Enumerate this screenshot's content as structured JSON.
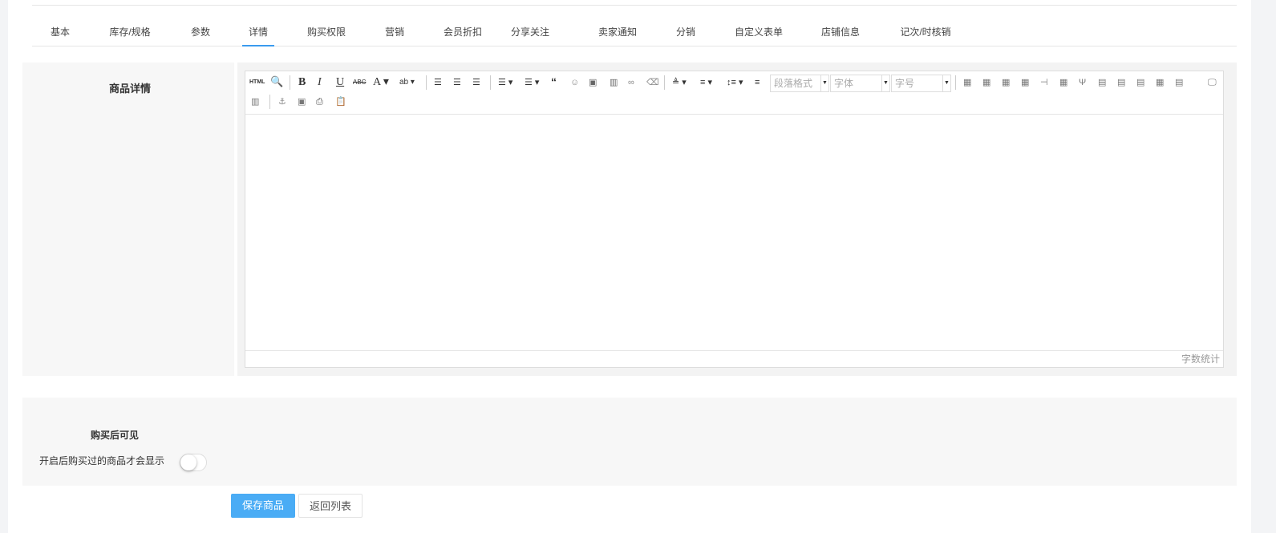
{
  "tabs": [
    "基本",
    "库存/规格",
    "参数",
    "详情",
    "购买权限",
    "营销",
    "会员折扣",
    "分享关注",
    "卖家通知",
    "分销",
    "自定义表单",
    "店铺信息",
    "记次/时核销"
  ],
  "active_tab": "详情",
  "detail": {
    "label": "商品详情",
    "editor": {
      "toolbar_icons": [
        "html-icon",
        "preview-icon",
        "bold-icon",
        "italic-icon",
        "underline-icon",
        "strikethrough-icon",
        "font-color-icon",
        "highlight-icon",
        "align-left-icon",
        "align-center-icon",
        "align-right-icon",
        "ordered-list-icon",
        "unordered-list-icon",
        "blockquote-icon",
        "emoji-icon",
        "image-icon",
        "video-icon",
        "link-icon",
        "eraser-icon",
        "paragraph-spacing-top-icon",
        "paragraph-spacing-bottom-icon",
        "line-height-icon",
        "indent-icon",
        "table-icons",
        "fullscreen-icon",
        "anchor-icon",
        "insert-frame-icon",
        "print-icon",
        "paste-icon"
      ],
      "html_label": "HTML",
      "paragraph_placeholder": "段落格式",
      "font_placeholder": "字体",
      "size_placeholder": "字号",
      "word_count": "字数统计"
    }
  },
  "purchase_visible": {
    "label": "购买后可见",
    "description": "开启后购买过的商品才会显示",
    "enabled": false
  },
  "buttons": {
    "save": "保存商品",
    "back": "返回列表"
  },
  "colors": {
    "primary": "#4aacf5"
  }
}
